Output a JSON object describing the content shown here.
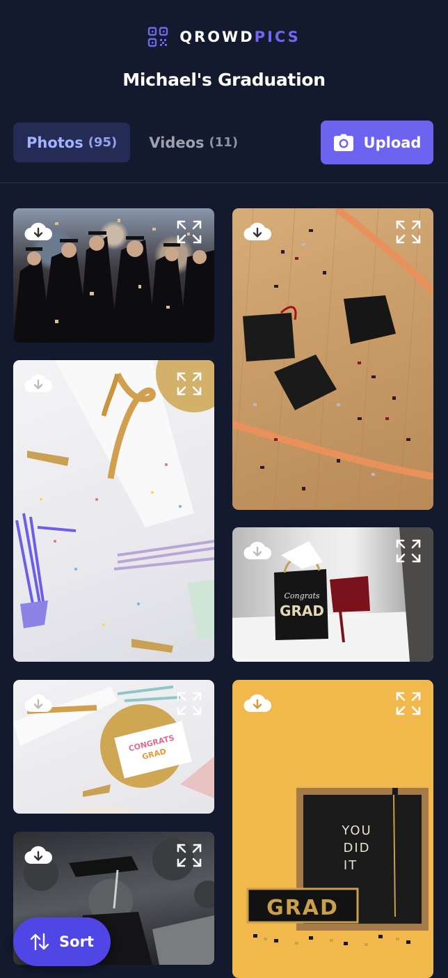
{
  "brand": {
    "part1": "QROWD",
    "part2": "PICS",
    "logo_icon": "qr-code-icon",
    "accent": "#6e6af0"
  },
  "event": {
    "title": "Michael's Graduation"
  },
  "tabs": [
    {
      "label": "Photos",
      "count": "(95)",
      "active": true
    },
    {
      "label": "Videos",
      "count": "(11)",
      "active": false
    }
  ],
  "upload": {
    "label": "Upload",
    "icon": "camera-icon",
    "color": "#6c63f0"
  },
  "gallery": {
    "download_icon": "cloud-download-icon",
    "expand_icon": "expand-icon",
    "photos": [
      {
        "subject": "graduates celebrating with confetti"
      },
      {
        "subject": "diploma with gold ribbon and tassels"
      },
      {
        "subject": "congrats grad card on white table"
      },
      {
        "subject": "graduate in cap, black and white"
      },
      {
        "subject": "graduation caps on wooden floor with confetti"
      },
      {
        "subject": "congrats grad gift bag"
      },
      {
        "subject": "YOU DID IT letter board and GRAD banner"
      }
    ],
    "letterboard": [
      "YOU",
      "DID",
      "IT"
    ],
    "banner": "GRAD",
    "gift_bag": [
      "Congrats",
      "GRAD"
    ],
    "card_text": [
      "CONGRATS",
      "GRAD"
    ]
  },
  "sort": {
    "label": "Sort",
    "icon": "sort-arrows-icon"
  },
  "colors": {
    "background": "#131a2e",
    "tab_active_bg": "#242c56",
    "tab_active_text": "#a3b2ff",
    "sort_bg": "#4f46e5"
  }
}
